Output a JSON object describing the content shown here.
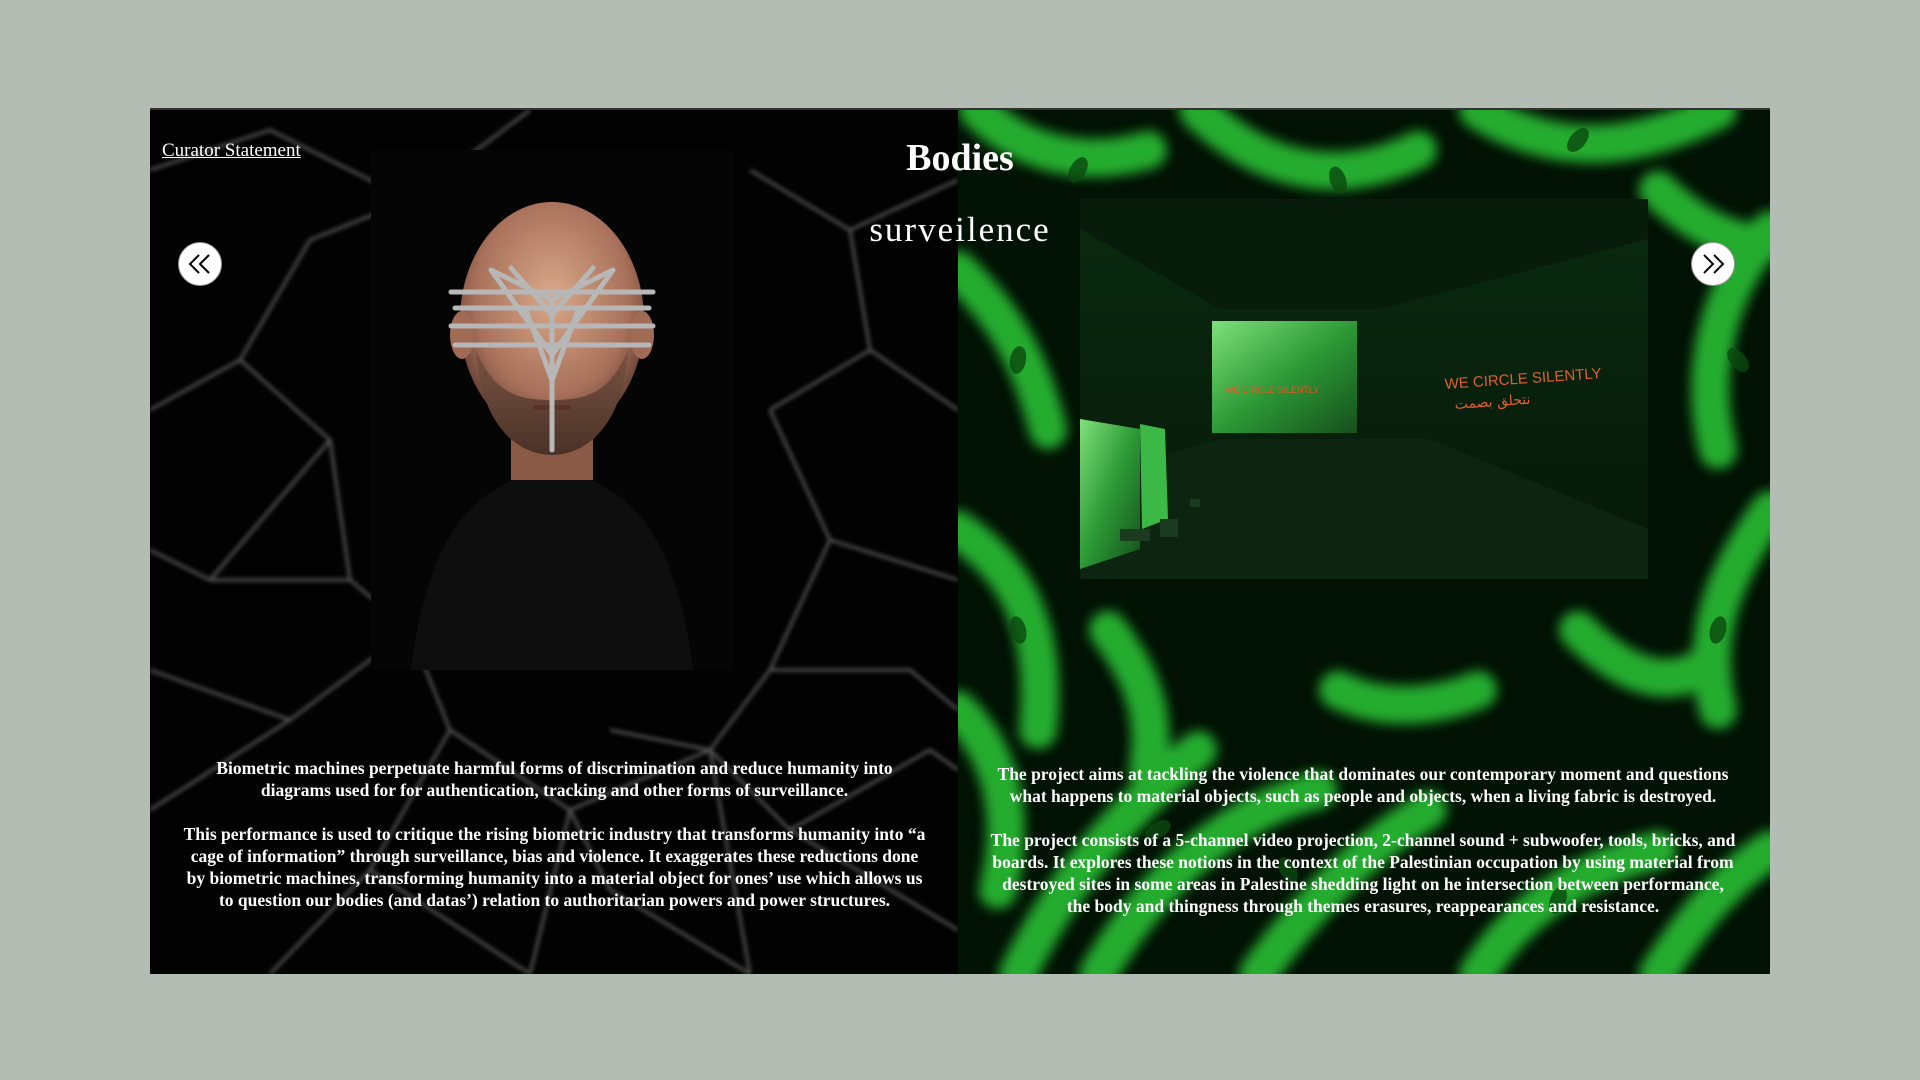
{
  "header": {
    "curator_link": "Curator Statement",
    "title": "Bodies",
    "subtitle": "surveilence"
  },
  "navigation": {
    "prev_icon": "double-chevron-left-icon",
    "next_icon": "double-chevron-right-icon"
  },
  "left_panel": {
    "background": "black with white geometric mesh lines",
    "image_description": "portrait of a man wearing a metal facial sculpture",
    "paragraphs": [
      "Biometric machines perpetuate harmful forms of discrimination and reduce humanity into diagrams used for for authentication, tracking and other forms of surveillance.",
      "This performance is used to critique the rising biometric industry that transforms humanity into “a cage of information” through surveillance, bias and violence. It exaggerates these reductions done by biometric machines, transforming humanity into a material object for ones’ use which allows us to question our bodies (and datas’) relation to authoritarian powers and power structures."
    ]
  },
  "right_panel": {
    "background": "green leafy stripes",
    "image_texts": [
      "WE CIRCLE SILENTLY",
      "نتحلق بصمت"
    ],
    "paragraphs": [
      "The project aims at tackling the violence that dominates our contemporary moment and questions what happens to material objects, such as people and objects, when a living fabric is destroyed.",
      "The project consists of a 5-channel video projection, 2-channel sound + subwoofer, tools, bricks, and boards. It explores these notions in the context of the Palestinian occupation by using material from destroyed sites in some areas in Palestine shedding light on he intersection between performance, the body and thingness through themes erasures, reappearances and resistance."
    ]
  },
  "colors": {
    "page_background": "#b4bdb3",
    "accent_green": "#2fd83a",
    "text": "#ffffff"
  }
}
